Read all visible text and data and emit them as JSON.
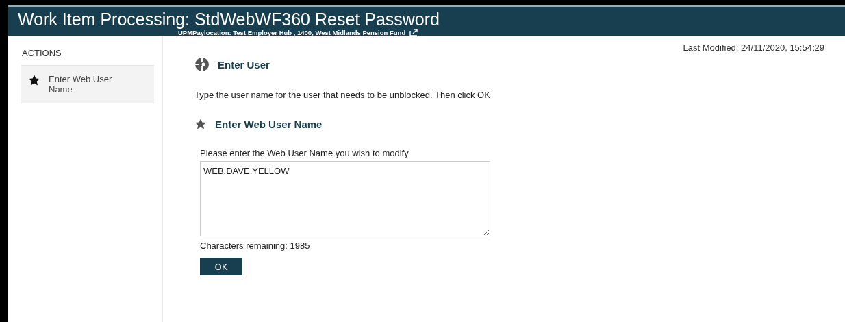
{
  "header": {
    "title": "Work Item Processing: StdWebWF360 Reset Password",
    "subtitle": "UPMPaylocation: Test Employer Hub , 1400, West Midlands Pension Fund"
  },
  "sidebar": {
    "heading": "ACTIONS",
    "items": [
      {
        "label": "Enter Web User Name",
        "selected": true
      }
    ]
  },
  "last_modified": "Last Modified: 24/11/2020, 15:54:29",
  "section": {
    "title": "Enter User",
    "instruction": "Type the user name for the user that needs to be unblocked. Then click OK"
  },
  "action": {
    "title": "Enter Web User Name",
    "field_label": "Please enter the Web User Name you wish to modify",
    "value": "WEB.DAVE.YELLOW",
    "remaining": "Characters remaining: 1985",
    "button": "OK"
  }
}
